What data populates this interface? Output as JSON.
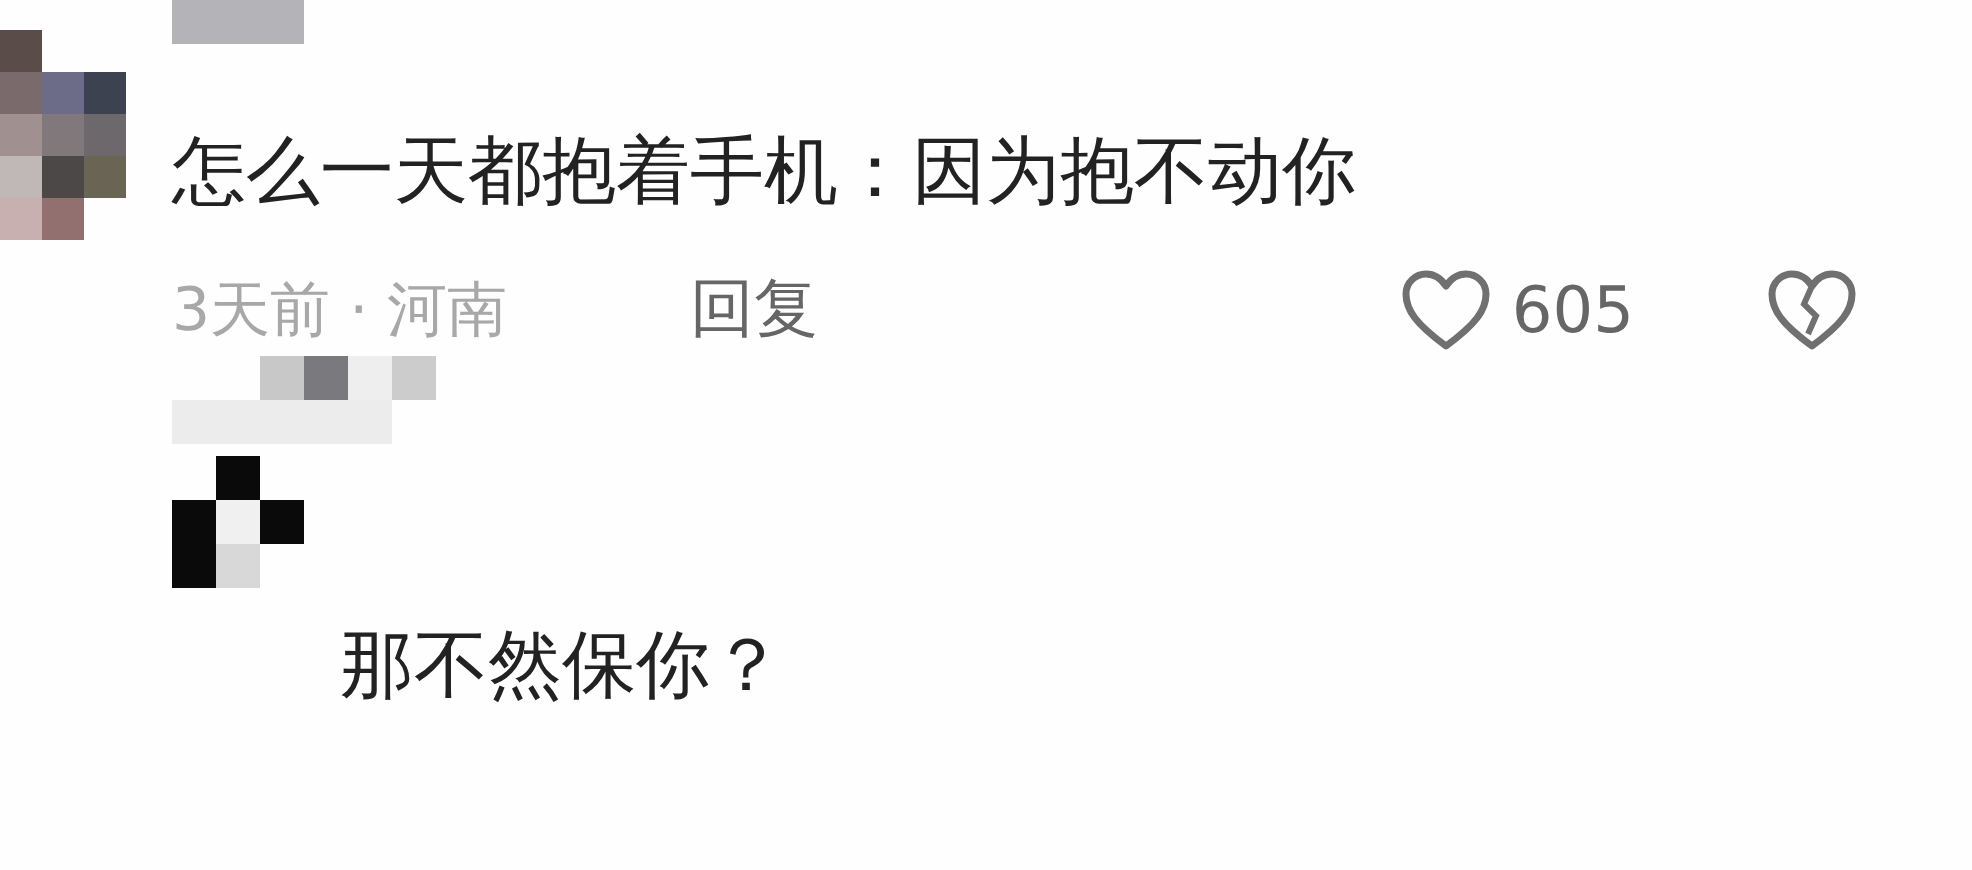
{
  "comment": {
    "text": "怎么一天都抱着手机：因为抱不动你",
    "meta": "3天前 · 河南",
    "reply_label": "回复",
    "like_count": "605"
  },
  "reply": {
    "text": "那不然保你？"
  }
}
